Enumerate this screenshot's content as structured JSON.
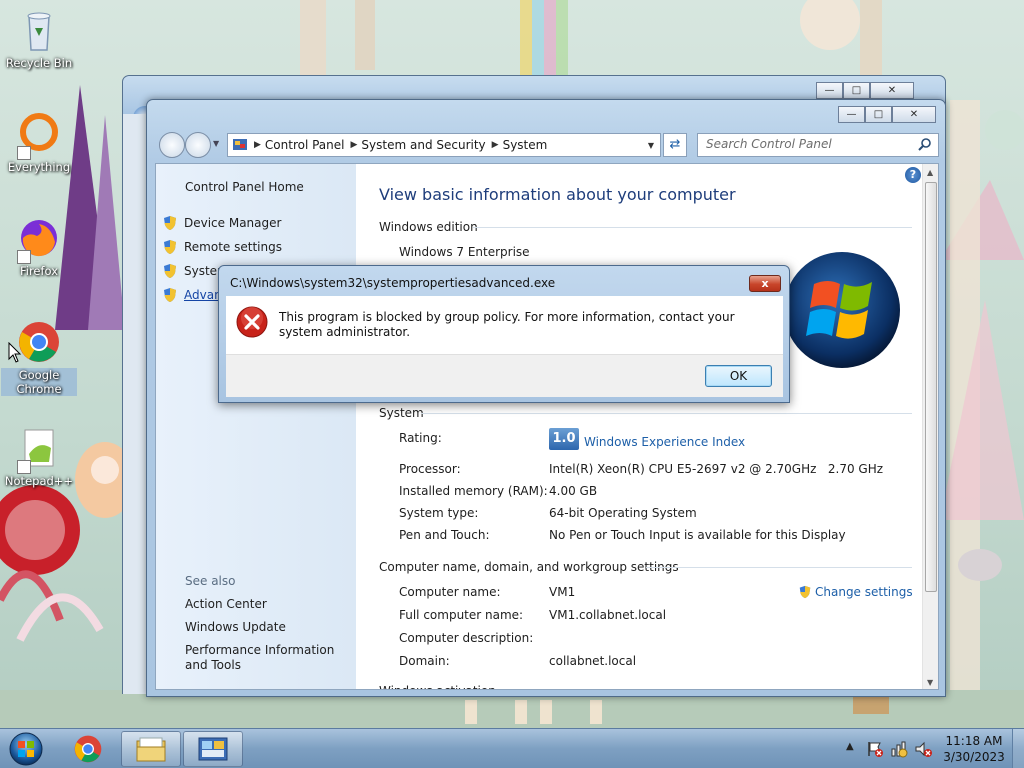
{
  "desktop": {
    "icons": [
      {
        "label": "Recycle Bin"
      },
      {
        "label": "Everything"
      },
      {
        "label": "Firefox"
      },
      {
        "label": "Google Chrome"
      },
      {
        "label": "Notepad++"
      }
    ]
  },
  "window": {
    "address": {
      "crumbs": [
        "Control Panel",
        "System and Security",
        "System"
      ]
    },
    "search_placeholder": "Search Control Panel",
    "left_pane": {
      "home": "Control Panel Home",
      "links": [
        "Device Manager",
        "Remote settings",
        "System protection",
        "Advanced system settings"
      ],
      "see_also_heading": "See also",
      "see_also": [
        "Action Center",
        "Windows Update",
        "Performance Information and Tools"
      ]
    },
    "main": {
      "title": "View basic information about your computer",
      "edition_heading": "Windows edition",
      "edition": "Windows 7 Enterprise",
      "system_heading": "System",
      "system_rows": [
        {
          "label": "Rating:",
          "value": "Windows Experience Index"
        },
        {
          "label": "Processor:",
          "value": "Intel(R) Xeon(R) CPU E5-2697 v2 @ 2.70GHz   2.70 GHz"
        },
        {
          "label": "Installed memory (RAM):",
          "value": "4.00 GB"
        },
        {
          "label": "System type:",
          "value": "64-bit Operating System"
        },
        {
          "label": "Pen and Touch:",
          "value": "No Pen or Touch Input is available for this Display"
        }
      ],
      "wei_score": "1.0",
      "computer_heading": "Computer name, domain, and workgroup settings",
      "computer_rows": [
        {
          "label": "Computer name:",
          "value": "VM1"
        },
        {
          "label": "Full computer name:",
          "value": "VM1.collabnet.local"
        },
        {
          "label": "Computer description:",
          "value": ""
        },
        {
          "label": "Domain:",
          "value": "collabnet.local"
        }
      ],
      "change_settings": "Change settings",
      "activation_heading_partial": "Windows activation"
    }
  },
  "dialog": {
    "title": "C:\\Windows\\system32\\systempropertiesadvanced.exe",
    "close_label": "x",
    "message": "This program is blocked by group policy. For more information, contact your system administrator.",
    "ok_label": "OK"
  },
  "taskbar": {
    "time": "11:18 AM",
    "date": "3/30/2023"
  },
  "colors": {
    "link": "#1d5fa8",
    "title_blue": "#1e3d7b",
    "error_red": "#c8231a"
  }
}
